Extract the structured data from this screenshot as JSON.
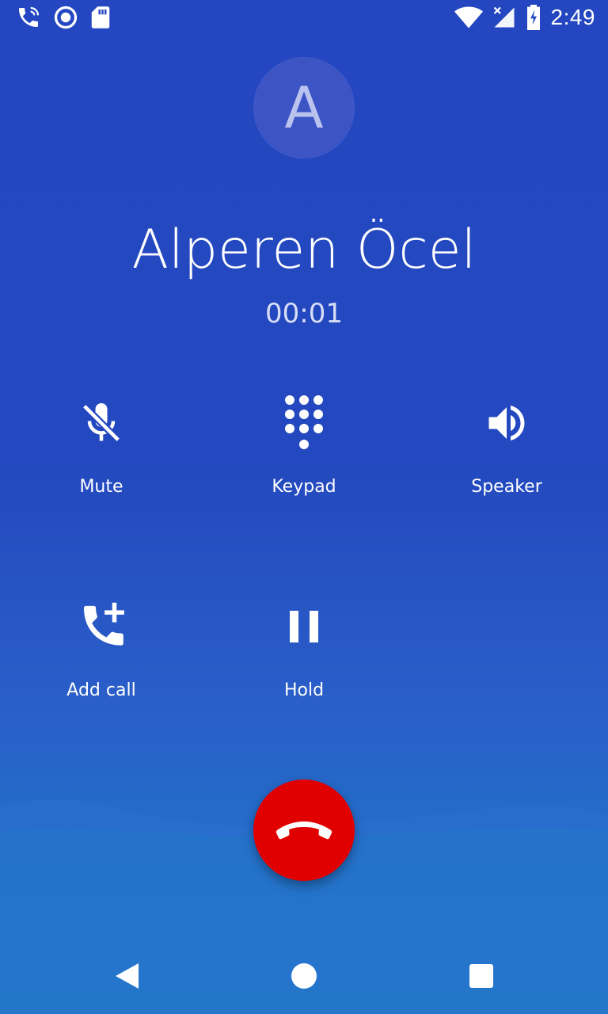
{
  "status_bar": {
    "time": "2:49",
    "icons_left": [
      "phone-in-call-icon",
      "record-icon",
      "sd-card-icon"
    ],
    "icons_right": [
      "wifi-icon",
      "cell-signal-icon",
      "battery-charging-icon"
    ]
  },
  "contact": {
    "avatar_letter": "A",
    "name": "Alperen Öcel",
    "duration": "00:01"
  },
  "controls": {
    "mute": "Mute",
    "keypad": "Keypad",
    "speaker": "Speaker",
    "add_call": "Add call",
    "hold": "Hold"
  },
  "colors": {
    "background": "#2447c1",
    "end_call": "#e00000"
  },
  "navigation": [
    "back-icon",
    "home-icon",
    "recents-icon"
  ]
}
